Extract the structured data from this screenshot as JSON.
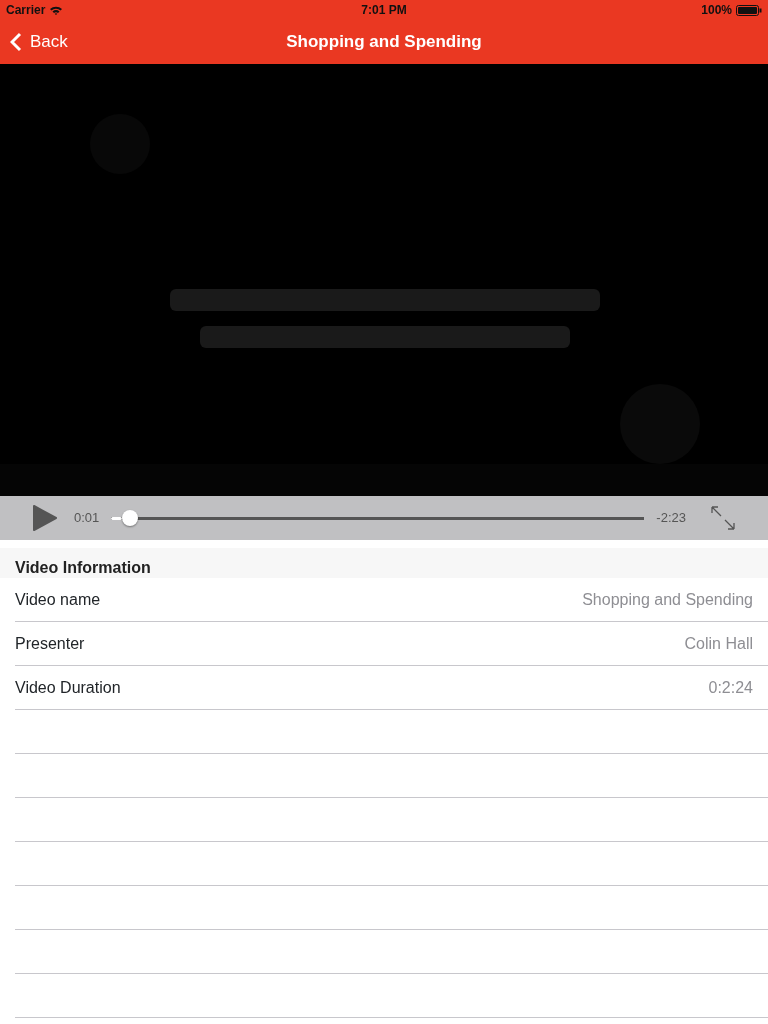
{
  "status_bar": {
    "carrier": "Carrier",
    "time": "7:01 PM",
    "battery": "100%"
  },
  "nav": {
    "back": "Back",
    "title": "Shopping and Spending"
  },
  "player": {
    "elapsed": "0:01",
    "remaining": "-2:23",
    "level": 0.02
  },
  "section": {
    "title": "Video Information",
    "rows": [
      {
        "label": "Video name",
        "value": "Shopping and Spending"
      },
      {
        "label": "Presenter",
        "value": "Colin Hall"
      },
      {
        "label": "Video Duration",
        "value": "0:2:24"
      }
    ]
  }
}
